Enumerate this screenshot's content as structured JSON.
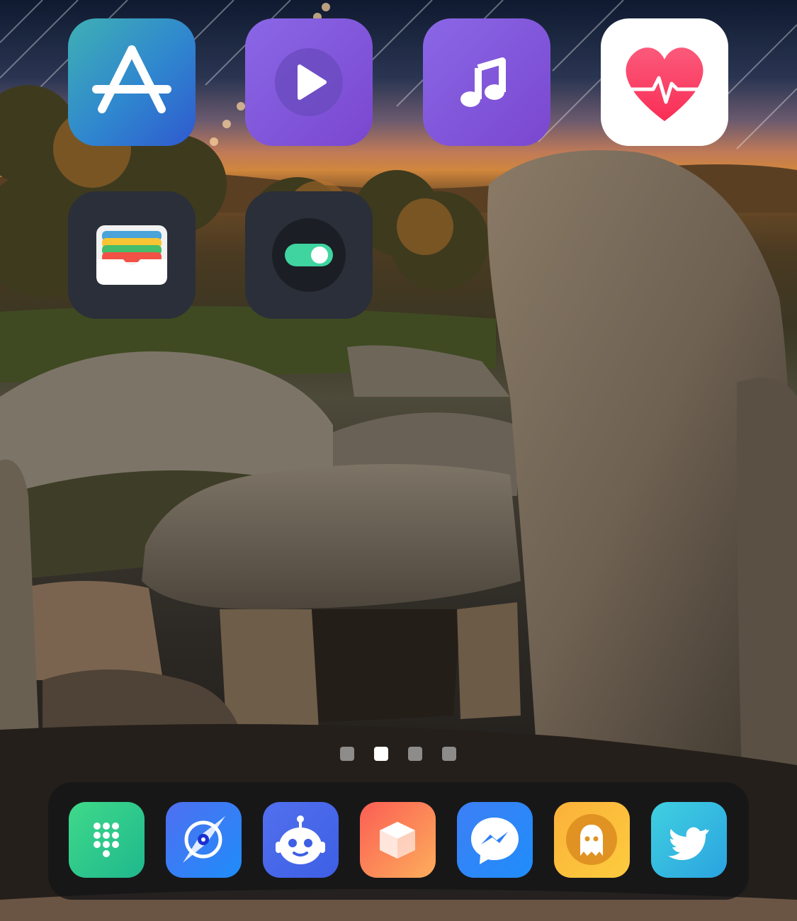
{
  "home_screen": {
    "apps": [
      {
        "icon": "app-store-icon"
      },
      {
        "icon": "play-video-icon"
      },
      {
        "icon": "music-note-icon"
      },
      {
        "icon": "health-heart-icon"
      },
      {
        "icon": "wallet-icon"
      },
      {
        "icon": "settings-toggle-icon"
      }
    ]
  },
  "page_indicator": {
    "pages": 4,
    "current_page": 2
  },
  "dock": {
    "apps": [
      {
        "icon": "phone-dialpad-icon"
      },
      {
        "icon": "browser-icon"
      },
      {
        "icon": "robot-assistant-icon"
      },
      {
        "icon": "box-icon"
      },
      {
        "icon": "messenger-icon"
      },
      {
        "icon": "ghost-icon"
      },
      {
        "icon": "twitter-bird-icon"
      }
    ]
  },
  "colors": {
    "app_store": "#2f86cf",
    "purple_apps": "#7a47cf",
    "health_heart": "#fb3a6b",
    "dark_tile": "#2a2f39",
    "toggle_green": "#3fd4a0",
    "dock_background": "#161618"
  }
}
